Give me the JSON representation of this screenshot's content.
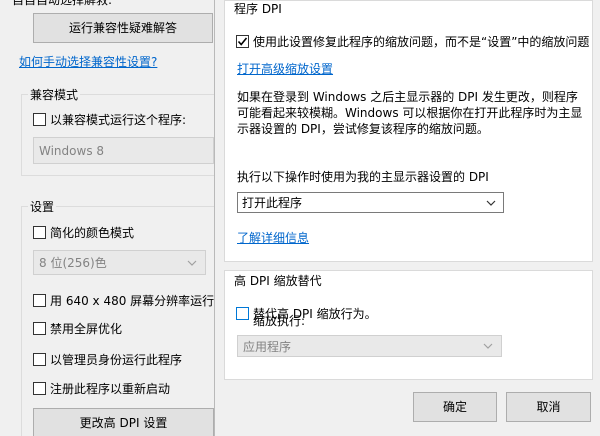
{
  "compat_window": {
    "cut_text": "自自自动选择解救:",
    "run_troubleshooter_button": "运行兼容性疑难解答",
    "manual_select_link": "如何手动选择兼容性设置?",
    "compat_mode": {
      "title": "兼容模式",
      "run_in_compat_checkbox": "以兼容模式运行这个程序:",
      "run_in_compat_checked": false,
      "os_select_value": "Windows 8"
    },
    "settings": {
      "title": "设置",
      "reduced_color_checkbox": "简化的颜色模式",
      "reduced_color_checked": false,
      "color_select_value": "8 位(256)色",
      "res_640_checkbox": "用 640 x 480 屏幕分辨率运行",
      "res_640_checked": false,
      "disable_fullscreen_checkbox": "禁用全屏优化",
      "disable_fullscreen_checked": false,
      "run_as_admin_checkbox": "以管理员身份运行此程序",
      "run_as_admin_checked": false,
      "register_restart_checkbox": "注册此程序以重新启动",
      "register_restart_checked": false,
      "change_dpi_button": "更改高 DPI 设置"
    }
  },
  "dpi_dialog": {
    "program_dpi": {
      "title": "程序 DPI",
      "fix_scaling_checkbox": "使用此设置修复此程序的缩放问题，而不是“设置”中的缩放问题",
      "fix_scaling_checked": true,
      "advanced_scaling_link": "打开高级缩放设置",
      "description_lines": [
        "如果在登录到 Windows 之后主显示器的 DPI 发生更改，则程序",
        "可能看起来较模糊。Windows 可以根据你在打开此程序时为主显",
        "示器设置的 DPI，尝试修复该程序的缩放问题。"
      ],
      "use_dpi_label": "执行以下操作时使用为我的主显示器设置的 DPI",
      "use_dpi_select_value": "打开此程序",
      "learn_more_link": "了解详细信息"
    },
    "high_dpi_override": {
      "title": "高 DPI 缩放替代",
      "override_checkbox": "替代高 DPI 缩放行为。",
      "override_checked": false,
      "scaling_performed_by_label": "缩放执行:",
      "scaling_select_value": "应用程序"
    },
    "ok_button": "确定",
    "cancel_button": "取消"
  }
}
